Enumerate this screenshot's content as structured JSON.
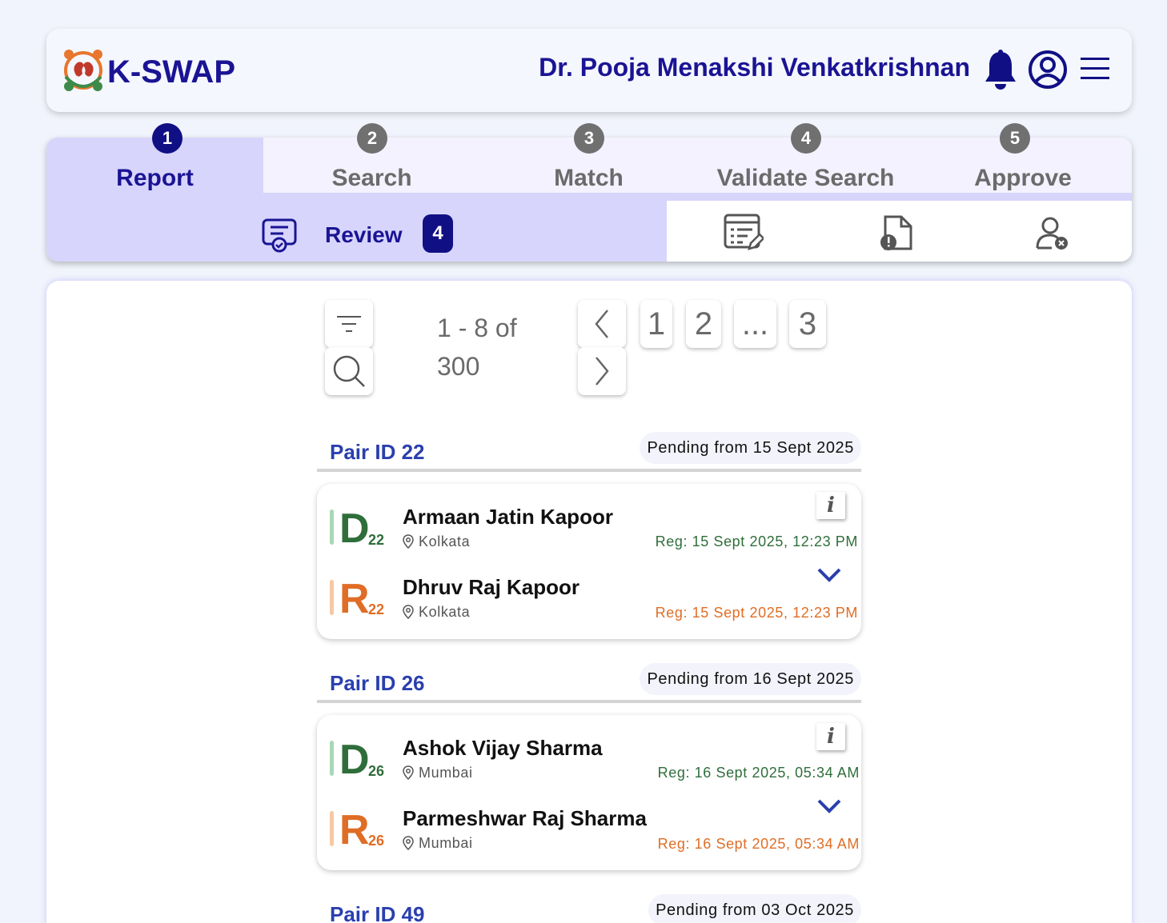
{
  "header": {
    "brand": "K-SWAP",
    "user_name": "Dr. Pooja Menakshi Venkatkrishnan",
    "icons": [
      "bell-icon",
      "user-circle-icon",
      "menu-icon"
    ]
  },
  "stepper": {
    "steps": [
      {
        "num": "1",
        "label": "Report",
        "active": true
      },
      {
        "num": "2",
        "label": "Search",
        "active": false
      },
      {
        "num": "3",
        "label": "Match",
        "active": false
      },
      {
        "num": "4",
        "label": "Validate Search",
        "active": false
      },
      {
        "num": "5",
        "label": "Approve",
        "active": false
      }
    ],
    "subtabs": {
      "review_label": "Review",
      "review_count": "4",
      "icons": [
        "review-certificate-icon",
        "list-edit-icon",
        "document-alert-icon",
        "user-remove-icon"
      ]
    },
    "colors": {
      "active": "#101084",
      "inactive": "#707070",
      "highlight": "#d7d5fb"
    }
  },
  "pagination": {
    "range_line1": "1 - 8 of",
    "range_line2": "300",
    "pages": [
      "1",
      "2",
      "...",
      "3"
    ]
  },
  "pairs": [
    {
      "pair_id": "Pair ID 22",
      "pending": "Pending from 15 Sept 2025",
      "donor": {
        "letter": "D",
        "num": "22",
        "name": "Armaan Jatin Kapoor",
        "city": "Kolkata",
        "reg": "Reg: 15 Sept 2025, 12:23 PM"
      },
      "recipient": {
        "letter": "R",
        "num": "22",
        "name": "Dhruv Raj Kapoor",
        "city": "Kolkata",
        "reg": "Reg: 15 Sept 2025, 12:23 PM"
      }
    },
    {
      "pair_id": "Pair ID 26",
      "pending": "Pending from 16 Sept 2025",
      "donor": {
        "letter": "D",
        "num": "26",
        "name": "Ashok Vijay Sharma",
        "city": "Mumbai",
        "reg": "Reg: 16 Sept 2025, 05:34 AM"
      },
      "recipient": {
        "letter": "R",
        "num": "26",
        "name": "Parmeshwar Raj Sharma",
        "city": "Mumbai",
        "reg": "Reg: 16 Sept 2025, 05:34 AM"
      }
    },
    {
      "pair_id": "Pair ID 49",
      "pending": "Pending from 03 Oct 2025"
    }
  ],
  "info_label": "i",
  "colors": {
    "donor": "#2f6e3b",
    "recipient": "#e06d25",
    "brand": "#1a1494",
    "pair_id": "#2a3fae"
  }
}
